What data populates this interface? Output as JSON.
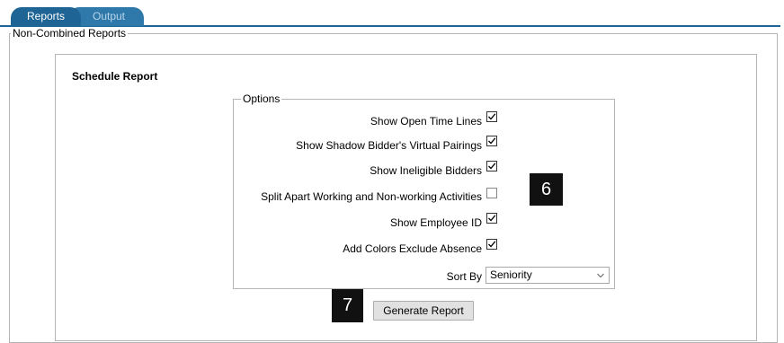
{
  "tabs": [
    {
      "label": "Reports"
    },
    {
      "label": "Output"
    }
  ],
  "outer_section": {
    "legend": "Non-Combined Reports"
  },
  "panel": {
    "title": "Schedule Report"
  },
  "options": {
    "legend": "Options",
    "items": [
      {
        "label": "Show Open Time Lines",
        "checked": true
      },
      {
        "label": "Show Shadow Bidder's Virtual Pairings",
        "checked": true
      },
      {
        "label": "Show Ineligible Bidders",
        "checked": true
      },
      {
        "label": "Split Apart Working and Non-working Activities",
        "checked": false
      },
      {
        "label": "Show Employee ID",
        "checked": true
      },
      {
        "label": "Add Colors Exclude Absence",
        "checked": true
      }
    ],
    "sort_by": {
      "label": "Sort By",
      "value": "Seniority"
    }
  },
  "generate_button": {
    "label": "Generate Report"
  },
  "callouts": [
    {
      "number": "6"
    },
    {
      "number": "7"
    }
  ]
}
